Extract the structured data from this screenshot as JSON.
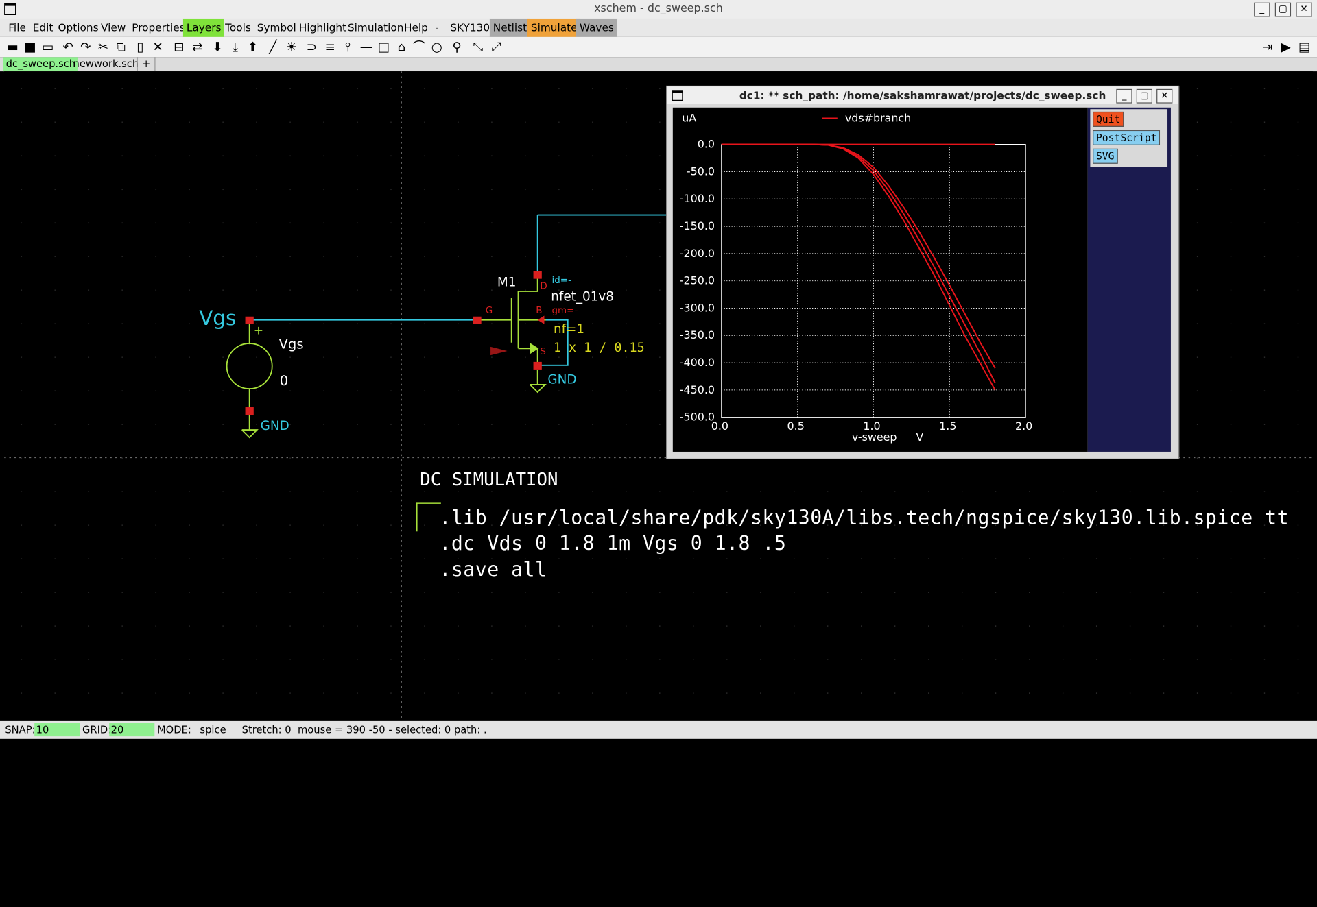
{
  "window": {
    "title": "xschem - dc_sweep.sch"
  },
  "menu": {
    "items": [
      "File",
      "Edit",
      "Options",
      "View",
      "Properties",
      "Layers",
      "Tools",
      "Symbol",
      "Highlight",
      "Simulation",
      "Help",
      "-",
      "SKY130",
      "Netlist",
      "Simulate",
      "Waves"
    ]
  },
  "tabs": [
    "dc_sweep.sch",
    "newwork.sch",
    "+"
  ],
  "schematic": {
    "source_label": "Vgs",
    "source_name": "Vgs",
    "source_value": "0",
    "plus_sign": "+",
    "gnd1": "GND",
    "gnd2": "GND",
    "mos_name": "M1",
    "mos_model": "nfet_01v8",
    "pin_g": "G",
    "pin_d": "D",
    "pin_b": "B",
    "pin_s": "S",
    "id_label": "id=-",
    "gm_label": "gm=-",
    "nf": "nf=1",
    "size": "1 x 1 / 0.15",
    "code_title": "DC_SIMULATION",
    "code_lines": [
      ".lib /usr/local/share/pdk/sky130A/libs.tech/ngspice/sky130.lib.spice tt",
      ".dc Vds 0 1.8 1m Vgs 0 1.8 .5",
      ".save all"
    ]
  },
  "graph_window": {
    "title": "dc1: ** sch_path: /home/sakshamrawat/projects/dc_sweep.sch",
    "buttons": {
      "quit": "Quit",
      "postscript": "PostScript",
      "svg": "SVG"
    }
  },
  "chart_data": {
    "type": "line",
    "ylabel": "uA",
    "xlabel": "v-sweep",
    "xunit": "V",
    "legend": "vds#branch",
    "xlim": [
      0.0,
      2.0
    ],
    "ylim": [
      -500.0,
      0.0
    ],
    "xticks": [
      "0.0",
      "0.5",
      "1.0",
      "1.5",
      "2.0"
    ],
    "yticks": [
      "0.0",
      "-50.0",
      "-100.0",
      "-150.0",
      "-200.0",
      "-250.0",
      "-300.0",
      "-350.0",
      "-400.0",
      "-450.0",
      "-500.0"
    ],
    "series": [
      {
        "x": [
          0.0,
          0.5,
          0.6,
          0.7,
          0.8,
          0.9,
          1.0,
          1.1,
          1.2,
          1.3,
          1.4,
          1.5,
          1.6,
          1.7,
          1.8
        ],
        "values": [
          0,
          0,
          0,
          -1,
          -8,
          -25,
          -55,
          -95,
          -140,
          -190,
          -240,
          -295,
          -350,
          -400,
          -450
        ]
      },
      {
        "x": [
          0.0,
          0.5,
          0.6,
          0.7,
          0.8,
          0.9,
          1.0,
          1.1,
          1.2,
          1.3,
          1.4,
          1.5,
          1.6,
          1.7,
          1.8
        ],
        "values": [
          0,
          0,
          0,
          -1,
          -7,
          -22,
          -48,
          -85,
          -128,
          -175,
          -225,
          -278,
          -330,
          -382,
          -437
        ]
      },
      {
        "x": [
          0.0,
          0.5,
          0.6,
          0.7,
          0.8,
          0.9,
          1.0,
          1.1,
          1.2,
          1.3,
          1.4,
          1.5,
          1.6,
          1.7,
          1.8
        ],
        "values": [
          0,
          0,
          0,
          -1,
          -6,
          -19,
          -42,
          -76,
          -116,
          -160,
          -208,
          -258,
          -310,
          -362,
          -410
        ]
      },
      {
        "x": [
          0.0,
          1.8
        ],
        "values": [
          0,
          0
        ]
      }
    ]
  },
  "status": {
    "snap_label": "SNAP:",
    "snap_value": "10",
    "grid_label": "GRID:",
    "grid_value": "20",
    "mode_label": "MODE:",
    "mode_value": "spice",
    "info": "Stretch: 0  mouse = 390 -50 - selected: 0 path: ."
  },
  "colors": {
    "wire": "#35c9e0",
    "component": "#a7e03a",
    "pin": "#d9201f",
    "curve": "#e8141b",
    "text": "#ffffff",
    "yellow": "#d8d71f"
  }
}
